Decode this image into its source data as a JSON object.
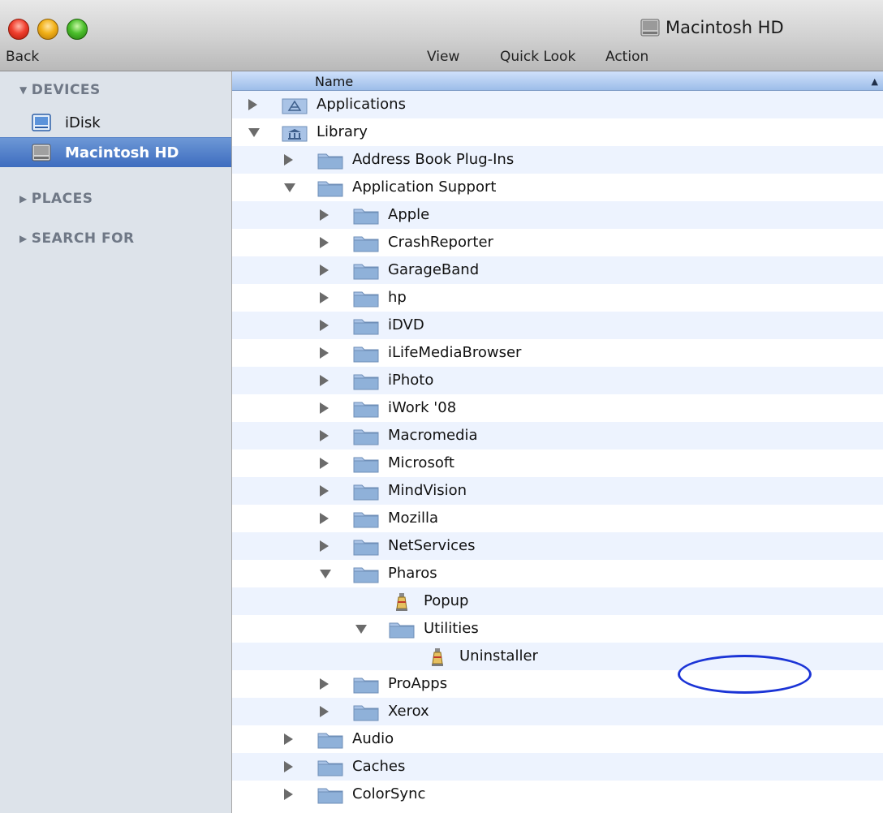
{
  "window": {
    "title": "Macintosh HD",
    "title_icon": "hard-drive-icon"
  },
  "toolbar": {
    "back": "Back",
    "view": "View",
    "quick_look": "Quick Look",
    "action": "Action"
  },
  "sidebar": {
    "sections": {
      "devices": "DEVICES",
      "places": "PLACES",
      "search_for": "SEARCH FOR"
    },
    "items": [
      {
        "label": "iDisk",
        "icon": "idisk-icon",
        "selected": false
      },
      {
        "label": "Macintosh HD",
        "icon": "hard-drive-icon",
        "selected": true
      }
    ]
  },
  "list": {
    "column_name": "Name",
    "sort_indicator": "▲",
    "rows": [
      {
        "label": "Applications",
        "depth": 0,
        "expander": "closed",
        "icon": "applications-folder-icon"
      },
      {
        "label": "Library",
        "depth": 0,
        "expander": "open",
        "icon": "library-folder-icon"
      },
      {
        "label": "Address Book Plug-Ins",
        "depth": 1,
        "expander": "closed",
        "icon": "folder-icon"
      },
      {
        "label": "Application Support",
        "depth": 1,
        "expander": "open",
        "icon": "folder-icon"
      },
      {
        "label": "Apple",
        "depth": 2,
        "expander": "closed",
        "icon": "folder-icon"
      },
      {
        "label": "CrashReporter",
        "depth": 2,
        "expander": "closed",
        "icon": "folder-icon"
      },
      {
        "label": "GarageBand",
        "depth": 2,
        "expander": "closed",
        "icon": "folder-icon"
      },
      {
        "label": "hp",
        "depth": 2,
        "expander": "closed",
        "icon": "folder-icon"
      },
      {
        "label": "iDVD",
        "depth": 2,
        "expander": "closed",
        "icon": "folder-icon"
      },
      {
        "label": "iLifeMediaBrowser",
        "depth": 2,
        "expander": "closed",
        "icon": "folder-icon"
      },
      {
        "label": "iPhoto",
        "depth": 2,
        "expander": "closed",
        "icon": "folder-icon"
      },
      {
        "label": "iWork '08",
        "depth": 2,
        "expander": "closed",
        "icon": "folder-icon"
      },
      {
        "label": "Macromedia",
        "depth": 2,
        "expander": "closed",
        "icon": "folder-icon"
      },
      {
        "label": "Microsoft",
        "depth": 2,
        "expander": "closed",
        "icon": "folder-icon"
      },
      {
        "label": "MindVision",
        "depth": 2,
        "expander": "closed",
        "icon": "folder-icon"
      },
      {
        "label": "Mozilla",
        "depth": 2,
        "expander": "closed",
        "icon": "folder-icon"
      },
      {
        "label": "NetServices",
        "depth": 2,
        "expander": "closed",
        "icon": "folder-icon"
      },
      {
        "label": "Pharos",
        "depth": 2,
        "expander": "open",
        "icon": "folder-icon"
      },
      {
        "label": "Popup",
        "depth": 3,
        "expander": "none",
        "icon": "pharos-app-icon"
      },
      {
        "label": "Utilities",
        "depth": 3,
        "expander": "open",
        "icon": "folder-icon"
      },
      {
        "label": "Uninstaller",
        "depth": 4,
        "expander": "none",
        "icon": "pharos-app-icon"
      },
      {
        "label": "ProApps",
        "depth": 2,
        "expander": "closed",
        "icon": "folder-icon"
      },
      {
        "label": "Xerox",
        "depth": 2,
        "expander": "closed",
        "icon": "folder-icon"
      },
      {
        "label": "Audio",
        "depth": 1,
        "expander": "closed",
        "icon": "folder-icon"
      },
      {
        "label": "Caches",
        "depth": 1,
        "expander": "closed",
        "icon": "folder-icon"
      },
      {
        "label": "ColorSync",
        "depth": 1,
        "expander": "closed",
        "icon": "folder-icon"
      }
    ]
  },
  "colors": {
    "selection": "#3d6cbf",
    "folder": "#8fb1d9",
    "annotation_oval": "#1b34d6"
  }
}
